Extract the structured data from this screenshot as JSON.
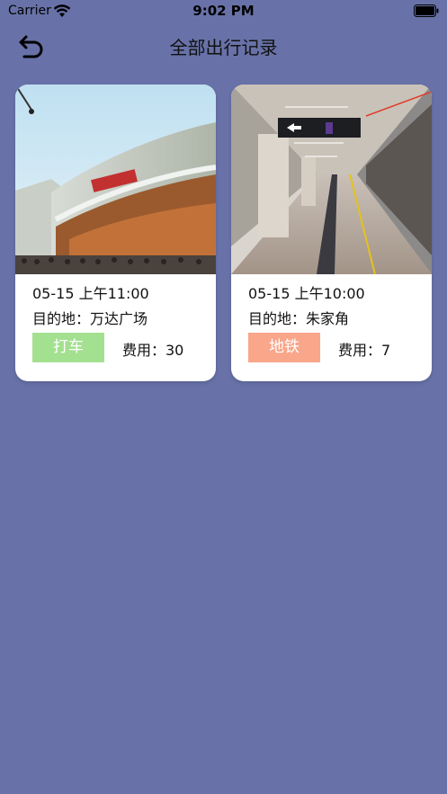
{
  "status_bar": {
    "carrier": "Carrier",
    "time": "9:02 PM"
  },
  "nav": {
    "back_icon": "undo-arrow-icon",
    "title": "全部出行记录"
  },
  "records": [
    {
      "image": "wanda-plaza-photo",
      "time": "05-15 上午11:00",
      "destination": "目的地：万达广场",
      "mode": "打车",
      "mode_color": "#a3e08f",
      "cost": "费用：30"
    },
    {
      "image": "metro-station-photo",
      "time": "05-15 上午10:00",
      "destination": "目的地：朱家角",
      "mode": "地铁",
      "mode_color": "#f9a68a",
      "cost": "费用：7"
    }
  ],
  "colors": {
    "background": "#6872a8",
    "card": "#ffffff"
  }
}
